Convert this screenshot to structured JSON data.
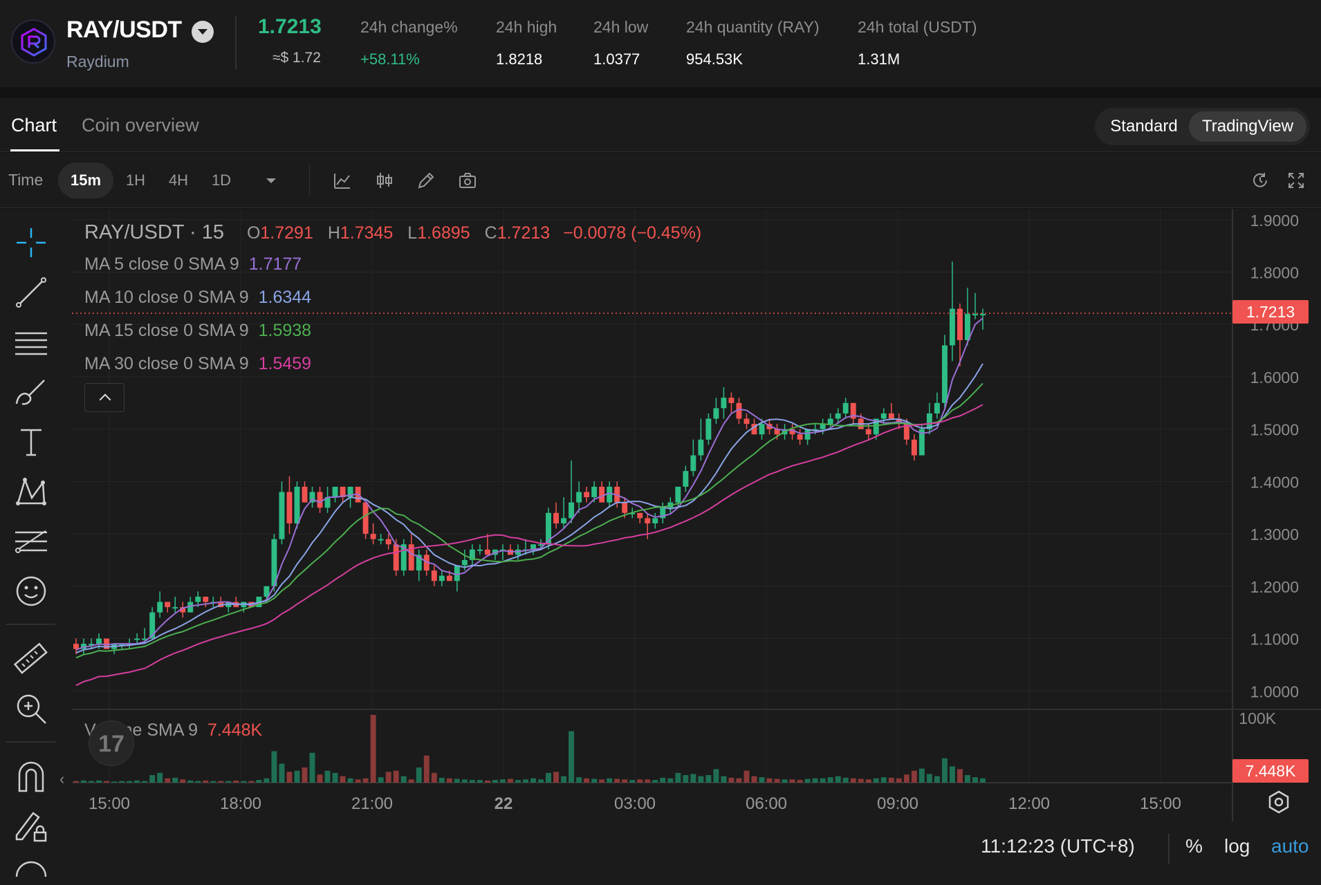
{
  "header": {
    "pair": "RAY/USDT",
    "coin_name": "Raydium",
    "price": "1.7213",
    "price_usd": "≈$ 1.72",
    "stats": [
      {
        "label": "24h change%",
        "value": "+58.11%",
        "positive": true
      },
      {
        "label": "24h high",
        "value": "1.8218"
      },
      {
        "label": "24h low",
        "value": "1.0377"
      },
      {
        "label": "24h quantity (RAY)",
        "value": "954.53K"
      },
      {
        "label": "24h total (USDT)",
        "value": "1.31M"
      }
    ]
  },
  "tabs": [
    {
      "label": "Chart",
      "active": true
    },
    {
      "label": "Coin overview",
      "active": false
    }
  ],
  "view_toggle": {
    "standard": "Standard",
    "tradingview": "TradingView",
    "selected": "TradingView"
  },
  "toolbar": {
    "time_label": "Time",
    "intervals": [
      {
        "label": "15m",
        "active": true
      },
      {
        "label": "1H"
      },
      {
        "label": "4H"
      },
      {
        "label": "1D"
      }
    ],
    "icons": [
      "chevron-down-icon",
      "indicator-icon",
      "candle-type-icon",
      "draw-icon",
      "camera-icon",
      "reset-icon",
      "fullscreen-icon"
    ]
  },
  "chart_legend": {
    "symbol": "RAY/USDT · 15",
    "o_label": "O",
    "o": "1.7291",
    "h_label": "H",
    "h": "1.7345",
    "l_label": "L",
    "l": "1.6895",
    "c_label": "C",
    "c": "1.7213",
    "change": "−0.0078 (−0.45%)",
    "ma": [
      {
        "label": "MA 5 close 0 SMA 9",
        "value": "1.7177",
        "color": "#9b6fd6"
      },
      {
        "label": "MA 10 close 0 SMA 9",
        "value": "1.6344",
        "color": "#8aa5e6"
      },
      {
        "label": "MA 15 close 0 SMA 9",
        "value": "1.5938",
        "color": "#4caf50"
      },
      {
        "label": "MA 30 close 0 SMA 9",
        "value": "1.5459",
        "color": "#d63fa0"
      }
    ],
    "volume_label": "Volume SMA 9",
    "volume_value": "7.448K"
  },
  "axis": {
    "price_ticks": [
      "1.9000",
      "1.8000",
      "1.7000",
      "1.6000",
      "1.5000",
      "1.4000",
      "1.3000",
      "1.2000",
      "1.1000",
      "1.0000"
    ],
    "price_tick_values": [
      1.9,
      1.8,
      1.7,
      1.6,
      1.5,
      1.4,
      1.3,
      1.2,
      1.1,
      1.0
    ],
    "volume_tick": "100K",
    "time_ticks": [
      "15:00",
      "18:00",
      "21:00",
      "22",
      "03:00",
      "06:00",
      "09:00",
      "12:00",
      "15:00"
    ],
    "current_price_tag": "1.7213",
    "current_volume_tag": "7.448K"
  },
  "footer": {
    "clock": "11:12:23 (UTC+8)",
    "percent": "%",
    "log": "log",
    "auto": "auto"
  },
  "colors": {
    "up": "#2ebd85",
    "down": "#f05350",
    "background": "#1b1b1b",
    "grid": "#262626"
  },
  "chart_data": {
    "type": "candlestick",
    "interval": "15m",
    "ylim": [
      1.0,
      1.9
    ],
    "candles": [
      [
        1.09,
        1.1,
        1.07,
        1.08
      ],
      [
        1.08,
        1.1,
        1.07,
        1.09
      ],
      [
        1.09,
        1.1,
        1.08,
        1.09
      ],
      [
        1.09,
        1.11,
        1.08,
        1.1
      ],
      [
        1.1,
        1.1,
        1.08,
        1.08
      ],
      [
        1.08,
        1.09,
        1.07,
        1.09
      ],
      [
        1.09,
        1.09,
        1.08,
        1.09
      ],
      [
        1.09,
        1.1,
        1.08,
        1.09
      ],
      [
        1.1,
        1.11,
        1.09,
        1.1
      ],
      [
        1.1,
        1.12,
        1.09,
        1.1
      ],
      [
        1.1,
        1.16,
        1.1,
        1.15
      ],
      [
        1.15,
        1.19,
        1.14,
        1.17
      ],
      [
        1.17,
        1.17,
        1.15,
        1.16
      ],
      [
        1.16,
        1.18,
        1.15,
        1.16
      ],
      [
        1.16,
        1.17,
        1.14,
        1.15
      ],
      [
        1.15,
        1.18,
        1.15,
        1.17
      ],
      [
        1.17,
        1.19,
        1.16,
        1.18
      ],
      [
        1.18,
        1.18,
        1.16,
        1.17
      ],
      [
        1.17,
        1.18,
        1.16,
        1.17
      ],
      [
        1.17,
        1.18,
        1.16,
        1.16
      ],
      [
        1.16,
        1.17,
        1.15,
        1.17
      ],
      [
        1.17,
        1.18,
        1.16,
        1.16
      ],
      [
        1.16,
        1.17,
        1.15,
        1.17
      ],
      [
        1.17,
        1.17,
        1.16,
        1.16
      ],
      [
        1.16,
        1.18,
        1.16,
        1.18
      ],
      [
        1.18,
        1.2,
        1.17,
        1.2
      ],
      [
        1.2,
        1.3,
        1.19,
        1.29
      ],
      [
        1.29,
        1.4,
        1.28,
        1.38
      ],
      [
        1.38,
        1.41,
        1.3,
        1.32
      ],
      [
        1.32,
        1.4,
        1.31,
        1.39
      ],
      [
        1.39,
        1.4,
        1.36,
        1.36
      ],
      [
        1.36,
        1.39,
        1.35,
        1.38
      ],
      [
        1.38,
        1.39,
        1.34,
        1.35
      ],
      [
        1.35,
        1.39,
        1.34,
        1.37
      ],
      [
        1.37,
        1.39,
        1.36,
        1.39
      ],
      [
        1.39,
        1.39,
        1.36,
        1.37
      ],
      [
        1.37,
        1.39,
        1.35,
        1.39
      ],
      [
        1.39,
        1.39,
        1.36,
        1.36
      ],
      [
        1.36,
        1.36,
        1.29,
        1.3
      ],
      [
        1.3,
        1.32,
        1.28,
        1.29
      ],
      [
        1.29,
        1.3,
        1.28,
        1.29
      ],
      [
        1.29,
        1.3,
        1.27,
        1.28
      ],
      [
        1.28,
        1.29,
        1.22,
        1.23
      ],
      [
        1.23,
        1.29,
        1.22,
        1.28
      ],
      [
        1.28,
        1.3,
        1.23,
        1.23
      ],
      [
        1.23,
        1.27,
        1.21,
        1.26
      ],
      [
        1.26,
        1.27,
        1.22,
        1.23
      ],
      [
        1.23,
        1.24,
        1.2,
        1.21
      ],
      [
        1.21,
        1.23,
        1.2,
        1.22
      ],
      [
        1.22,
        1.23,
        1.21,
        1.21
      ],
      [
        1.21,
        1.24,
        1.19,
        1.24
      ],
      [
        1.24,
        1.27,
        1.23,
        1.25
      ],
      [
        1.25,
        1.28,
        1.24,
        1.27
      ],
      [
        1.27,
        1.28,
        1.26,
        1.27
      ],
      [
        1.27,
        1.3,
        1.26,
        1.26
      ],
      [
        1.26,
        1.27,
        1.25,
        1.27
      ],
      [
        1.27,
        1.28,
        1.25,
        1.27
      ],
      [
        1.27,
        1.28,
        1.26,
        1.26
      ],
      [
        1.26,
        1.28,
        1.25,
        1.27
      ],
      [
        1.27,
        1.29,
        1.26,
        1.27
      ],
      [
        1.27,
        1.28,
        1.26,
        1.28
      ],
      [
        1.28,
        1.29,
        1.27,
        1.28
      ],
      [
        1.28,
        1.35,
        1.27,
        1.34
      ],
      [
        1.34,
        1.36,
        1.31,
        1.32
      ],
      [
        1.32,
        1.37,
        1.31,
        1.33
      ],
      [
        1.33,
        1.44,
        1.32,
        1.36
      ],
      [
        1.36,
        1.4,
        1.34,
        1.38
      ],
      [
        1.38,
        1.39,
        1.36,
        1.37
      ],
      [
        1.37,
        1.4,
        1.36,
        1.39
      ],
      [
        1.39,
        1.4,
        1.36,
        1.36
      ],
      [
        1.36,
        1.4,
        1.35,
        1.39
      ],
      [
        1.39,
        1.4,
        1.35,
        1.36
      ],
      [
        1.36,
        1.37,
        1.33,
        1.34
      ],
      [
        1.34,
        1.35,
        1.33,
        1.34
      ],
      [
        1.34,
        1.34,
        1.32,
        1.33
      ],
      [
        1.33,
        1.34,
        1.29,
        1.32
      ],
      [
        1.32,
        1.34,
        1.31,
        1.33
      ],
      [
        1.33,
        1.36,
        1.32,
        1.35
      ],
      [
        1.35,
        1.37,
        1.34,
        1.36
      ],
      [
        1.36,
        1.39,
        1.35,
        1.39
      ],
      [
        1.39,
        1.43,
        1.38,
        1.42
      ],
      [
        1.42,
        1.48,
        1.41,
        1.45
      ],
      [
        1.45,
        1.52,
        1.44,
        1.48
      ],
      [
        1.48,
        1.53,
        1.47,
        1.52
      ],
      [
        1.52,
        1.56,
        1.51,
        1.54
      ],
      [
        1.54,
        1.58,
        1.52,
        1.56
      ],
      [
        1.56,
        1.57,
        1.53,
        1.55
      ],
      [
        1.55,
        1.56,
        1.51,
        1.52
      ],
      [
        1.52,
        1.53,
        1.5,
        1.51
      ],
      [
        1.51,
        1.52,
        1.49,
        1.49
      ],
      [
        1.49,
        1.52,
        1.48,
        1.51
      ],
      [
        1.51,
        1.52,
        1.49,
        1.5
      ],
      [
        1.5,
        1.51,
        1.48,
        1.49
      ],
      [
        1.49,
        1.51,
        1.48,
        1.5
      ],
      [
        1.5,
        1.51,
        1.48,
        1.49
      ],
      [
        1.49,
        1.5,
        1.47,
        1.48
      ],
      [
        1.48,
        1.5,
        1.47,
        1.5
      ],
      [
        1.5,
        1.51,
        1.49,
        1.5
      ],
      [
        1.5,
        1.52,
        1.49,
        1.51
      ],
      [
        1.51,
        1.53,
        1.5,
        1.52
      ],
      [
        1.52,
        1.54,
        1.51,
        1.53
      ],
      [
        1.53,
        1.56,
        1.52,
        1.55
      ],
      [
        1.55,
        1.55,
        1.51,
        1.52
      ],
      [
        1.52,
        1.53,
        1.5,
        1.5
      ],
      [
        1.5,
        1.51,
        1.48,
        1.49
      ],
      [
        1.49,
        1.52,
        1.48,
        1.52
      ],
      [
        1.52,
        1.54,
        1.51,
        1.53
      ],
      [
        1.53,
        1.55,
        1.52,
        1.52
      ],
      [
        1.52,
        1.53,
        1.5,
        1.51
      ],
      [
        1.51,
        1.52,
        1.47,
        1.48
      ],
      [
        1.48,
        1.49,
        1.44,
        1.45
      ],
      [
        1.45,
        1.51,
        1.45,
        1.5
      ],
      [
        1.5,
        1.55,
        1.49,
        1.53
      ],
      [
        1.53,
        1.57,
        1.52,
        1.55
      ],
      [
        1.55,
        1.68,
        1.54,
        1.66
      ],
      [
        1.66,
        1.82,
        1.63,
        1.73
      ],
      [
        1.73,
        1.74,
        1.62,
        1.67
      ],
      [
        1.67,
        1.77,
        1.66,
        1.72
      ],
      [
        1.72,
        1.76,
        1.71,
        1.72
      ],
      [
        1.72,
        1.73,
        1.69,
        1.72
      ]
    ],
    "volumes_k": [
      3,
      4,
      3,
      4,
      3,
      2,
      3,
      3,
      4,
      3,
      14,
      18,
      8,
      9,
      6,
      4,
      3,
      4,
      3,
      3,
      3,
      4,
      3,
      3,
      5,
      8,
      58,
      35,
      20,
      22,
      28,
      55,
      15,
      22,
      18,
      12,
      8,
      6,
      8,
      125,
      10,
      20,
      22,
      12,
      6,
      28,
      50,
      18,
      9,
      8,
      7,
      6,
      5,
      5,
      4,
      5,
      6,
      7,
      5,
      6,
      8,
      6,
      18,
      20,
      12,
      95,
      10,
      8,
      7,
      6,
      8,
      7,
      6,
      5,
      6,
      6,
      5,
      9,
      8,
      18,
      14,
      16,
      12,
      14,
      25,
      12,
      9,
      8,
      22,
      12,
      10,
      8,
      7,
      6,
      6,
      5,
      7,
      8,
      8,
      10,
      12,
      9,
      8,
      7,
      6,
      8,
      10,
      9,
      8,
      15,
      22,
      26,
      16,
      12,
      45,
      30,
      25,
      14,
      10,
      8
    ],
    "ma5_end": 1.7177,
    "ma10_end": 1.6344,
    "ma15_end": 1.5938,
    "ma30_end": 1.5459
  }
}
